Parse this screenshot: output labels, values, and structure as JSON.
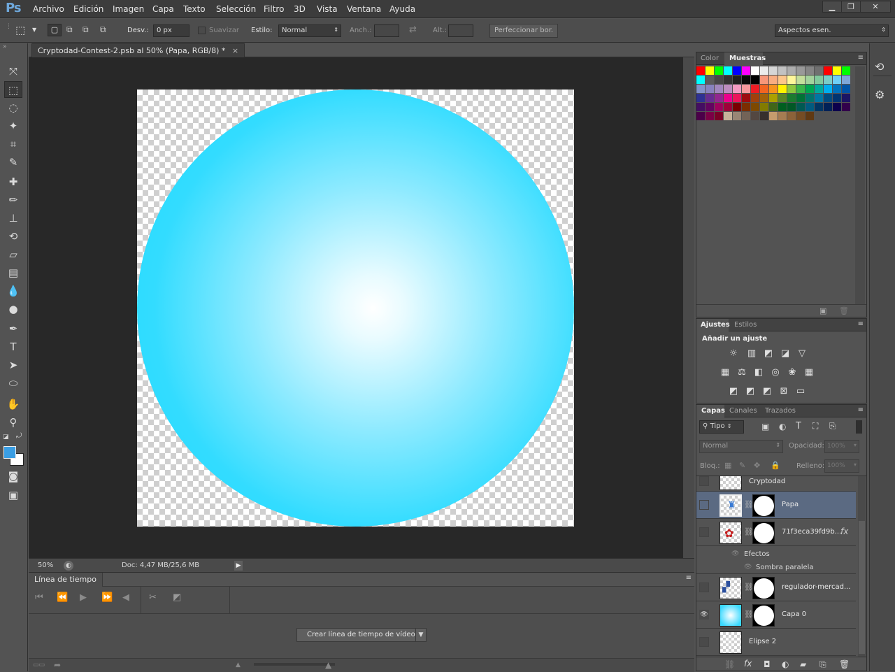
{
  "app": {
    "logo": "Ps"
  },
  "menu": [
    "Archivo",
    "Edición",
    "Imagen",
    "Capa",
    "Texto",
    "Selección",
    "Filtro",
    "3D",
    "Vista",
    "Ventana",
    "Ayuda"
  ],
  "options": {
    "feather_label": "Desv.:",
    "feather_value": "0 px",
    "antialias_label": "Suavizar",
    "style_label": "Estilo:",
    "style_value": "Normal",
    "width_label": "Anch.:",
    "height_label": "Alt.:",
    "refine_label": "Perfeccionar bor.",
    "workspace": "Aspectos esen."
  },
  "document": {
    "tab_title": "Cryptodad-Contest-2.psb al 50% (Papa, RGB/8) *",
    "zoom": "50%",
    "doc_info": "Doc: 4,47 MB/25,6 MB"
  },
  "timeline": {
    "title": "Línea de tiempo",
    "create_button": "Crear línea de tiempo de vídeo"
  },
  "swatches_panel": {
    "tabs": [
      "Color",
      "Muestras"
    ],
    "active_tab": "Muestras",
    "colors": [
      "#ff0000",
      "#ffff00",
      "#00ff00",
      "#00ffff",
      "#0000ff",
      "#ff00ff",
      "#ffffff",
      "#ebebeb",
      "#d6d6d6",
      "#c2c2c2",
      "#adadad",
      "#999999",
      "#858585",
      "#707070",
      "#ff0000",
      "#ffff00",
      "#00ff00",
      "#00ffff",
      "#5c5c5c",
      "#474747",
      "#333333",
      "#1f1f1f",
      "#0a0a0a",
      "#000000",
      "#f7977a",
      "#f9ad81",
      "#fdc68a",
      "#fff79a",
      "#c4df9b",
      "#a3d39c",
      "#82ca9d",
      "#7bcdc8",
      "#6ecff6",
      "#7ea7d8",
      "#8493ca",
      "#8882be",
      "#a187be",
      "#bc8dbf",
      "#f49ac2",
      "#f6989d",
      "#ed1c24",
      "#f26522",
      "#f7941d",
      "#fff200",
      "#8dc73f",
      "#39b54a",
      "#00a651",
      "#00a99d",
      "#00aeef",
      "#0072bc",
      "#0054a6",
      "#2e3192",
      "#662d91",
      "#92278f",
      "#ec008c",
      "#ed145b",
      "#9e0b0f",
      "#a0410d",
      "#a36209",
      "#aba000",
      "#598527",
      "#1a7b30",
      "#007236",
      "#00746b",
      "#0076a3",
      "#004b80",
      "#003471",
      "#1b1464",
      "#440e62",
      "#630460",
      "#9e005d",
      "#9e0039",
      "#790000",
      "#7b2e00",
      "#7d4900",
      "#827b00",
      "#406618",
      "#005e20",
      "#005826",
      "#005952",
      "#005b7f",
      "#003663",
      "#002157",
      "#0d004c",
      "#32004b",
      "#4b0049",
      "#7b0046",
      "#7a0026",
      "#c7b299",
      "#998675",
      "#736357",
      "#534741",
      "#37302d",
      "#c69c6d",
      "#a67c52",
      "#8c6239",
      "#754c24",
      "#603913"
    ]
  },
  "adjustments_panel": {
    "tabs": [
      "Ajustes",
      "Estilos"
    ],
    "heading": "Añadir un ajuste"
  },
  "layers_panel": {
    "tabs": [
      "Capas",
      "Canales",
      "Trazados"
    ],
    "filter": "Tipo",
    "blend_mode": "Normal",
    "opacity_label": "Opacidad:",
    "opacity_value": "100%",
    "lock_label": "Bloq.:",
    "fill_label": "Relleno:",
    "fill_value": "100%",
    "effects_label": "Efectos",
    "effect_name": "Sombra paralela",
    "layers": [
      {
        "name": "Cryptodad",
        "visible": false
      },
      {
        "name": "Papa",
        "visible": false,
        "selected": true
      },
      {
        "name": "71f3eca39fd9b...",
        "visible": false
      },
      {
        "name": "regulador-mercad...",
        "visible": false
      },
      {
        "name": "Capa 0",
        "visible": true
      },
      {
        "name": "Elipse 2",
        "visible": false
      }
    ]
  },
  "colors": {
    "foreground": "#3a9ee4",
    "background": "#ffffff",
    "sphere_edge": "#1adaff",
    "selection": "#5b6a82"
  }
}
